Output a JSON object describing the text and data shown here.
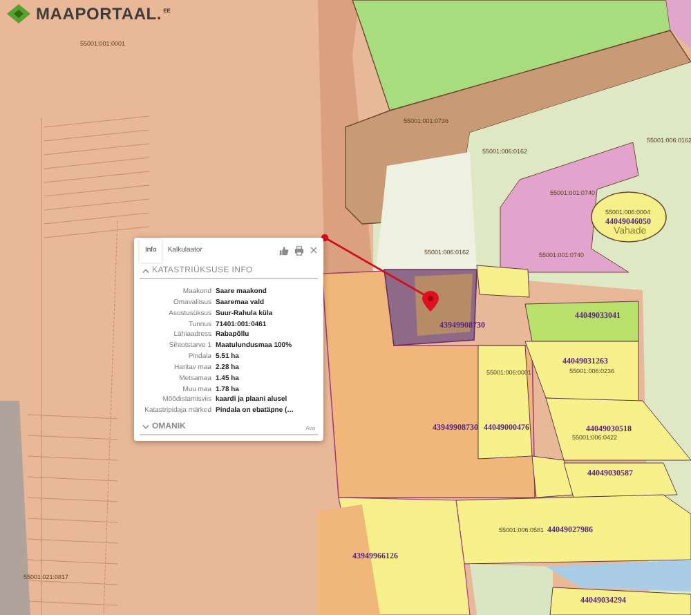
{
  "logo": {
    "text": "MAAPORTAAL.",
    "suffix": "EE"
  },
  "map": {
    "labels": [
      {
        "text": "55001:001:0001",
        "kind": "code"
      },
      {
        "text": "55001:001:0736",
        "kind": "code"
      },
      {
        "text": "55001:006:0162",
        "kind": "code"
      },
      {
        "text": "55001:006:0162",
        "kind": "code"
      },
      {
        "text": "55001:001:0740",
        "kind": "code"
      },
      {
        "text": "55001:006:0004",
        "kind": "code"
      },
      {
        "text": "44049046050",
        "kind": "number"
      },
      {
        "text": "Vahade",
        "kind": "place"
      },
      {
        "text": "55001:006:0162",
        "kind": "code"
      },
      {
        "text": "55001:001:0740",
        "kind": "code"
      },
      {
        "text": "43949908730",
        "kind": "number"
      },
      {
        "text": "44049033041",
        "kind": "number"
      },
      {
        "text": "55001:006:0001",
        "kind": "code"
      },
      {
        "text": "44049031263",
        "kind": "number"
      },
      {
        "text": "55001:006:0236",
        "kind": "code"
      },
      {
        "text": "43949908730",
        "kind": "number"
      },
      {
        "text": "44049000476",
        "kind": "number"
      },
      {
        "text": "44049030518",
        "kind": "number"
      },
      {
        "text": "55001:006:0422",
        "kind": "code"
      },
      {
        "text": "44049030587",
        "kind": "number"
      },
      {
        "text": "55001:006:0581",
        "kind": "code"
      },
      {
        "text": "44049027986",
        "kind": "number"
      },
      {
        "text": "43949966126",
        "kind": "number"
      },
      {
        "text": "55001:021:0817",
        "kind": "code"
      },
      {
        "text": "44049034294",
        "kind": "number"
      }
    ]
  },
  "popup": {
    "tabs": [
      {
        "label": "Info",
        "selected": true
      },
      {
        "label": "Kalkulaator",
        "selected": false
      }
    ],
    "section": {
      "title": "KATASTRIÜKSUSE INFO",
      "expanded": true
    },
    "rows": [
      {
        "label": "Maakond",
        "value": "Saare maakond"
      },
      {
        "label": "Omavalitsus",
        "value": "Saaremaa vald"
      },
      {
        "label": "Asustusüksus",
        "value": "Suur-Rahula küla"
      },
      {
        "label": "Tunnus",
        "value": "71401:001:0461"
      },
      {
        "label": "Lähiaadress",
        "value": "Rabapõllu"
      },
      {
        "label": "Sihtotstarve 1",
        "value": "Maatulundusmaa 100%"
      },
      {
        "label": "Pindala",
        "value": "5.51 ha"
      },
      {
        "label": "Haritav maa",
        "value": "2.28 ha"
      },
      {
        "label": "Metsamaa",
        "value": "1.45 ha"
      },
      {
        "label": "Muu maa",
        "value": "1.78 ha"
      },
      {
        "label": "Mõõdistamisviis",
        "value": "kaardi ja plaani alusel"
      },
      {
        "label": "Katastripidaja märked",
        "value": "Pindala on ebatäpne (…"
      }
    ],
    "footer": {
      "title": "OMANIK",
      "expanded": false,
      "action": "Ava"
    }
  }
}
